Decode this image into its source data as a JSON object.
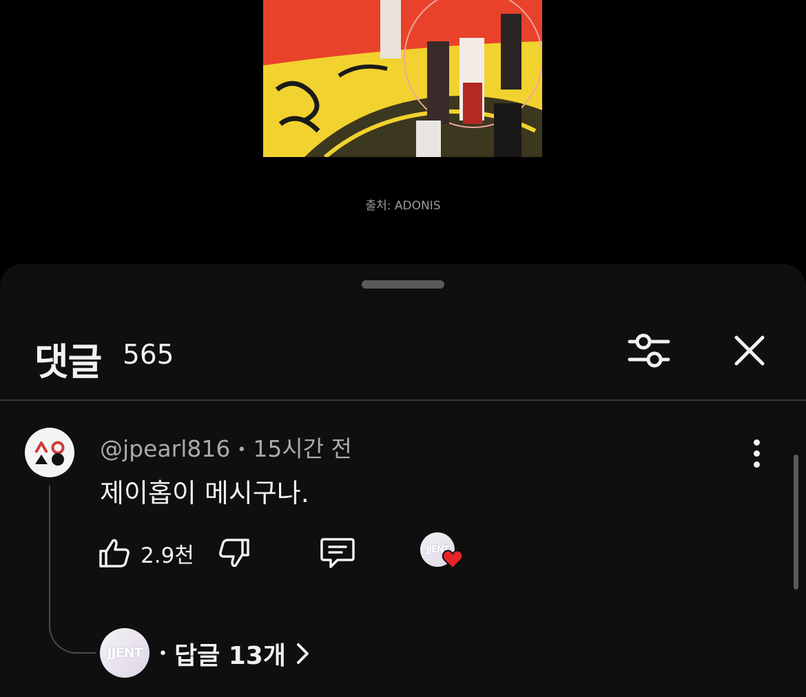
{
  "video": {
    "source_caption": "출처: ADONIS"
  },
  "sheet": {
    "title": "댓글",
    "count": "565"
  },
  "comment": {
    "author": "@jpearl816",
    "time": "15시간 전",
    "text": "제이홉이 메시구나.",
    "like_count": "2.9천",
    "creator_heart_avatar_text": "JJENT",
    "replies_avatar_text": "JJENT",
    "replies_label": "답글 13개"
  },
  "colors": {
    "sheet_background": "#0f0f0f",
    "heart": "#e8232a"
  },
  "icons": {
    "filter": "sliders-icon",
    "close": "close-icon",
    "more": "more-vertical-icon",
    "like": "thumbs-up-icon",
    "dislike": "thumbs-down-icon",
    "reply": "comment-icon",
    "heart": "heart-icon",
    "chevron": "chevron-right-icon"
  }
}
